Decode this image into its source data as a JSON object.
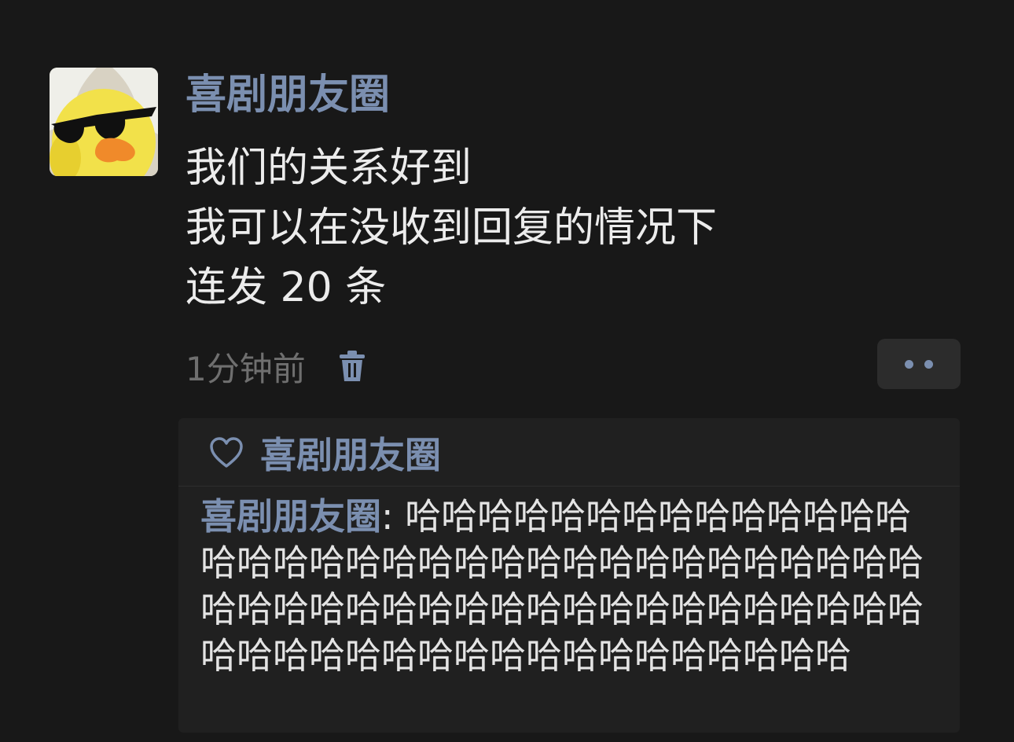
{
  "post": {
    "avatar_icon": "duck-with-sunglasses-avatar",
    "username": "喜剧朋友圈",
    "lines": [
      "我们的关系好到",
      "我可以在没收到回复的情况下",
      "连发 20 条"
    ],
    "timestamp": "1分钟前",
    "delete_icon": "trash-icon",
    "more_icon": "more-dots-icon"
  },
  "interactions": {
    "like_icon": "heart-icon",
    "liked_by": "喜剧朋友圈",
    "comment": {
      "author": "喜剧朋友圈",
      "separator": ": ",
      "text": "哈哈哈哈哈哈哈哈哈哈哈哈哈哈哈哈哈哈哈哈哈哈哈哈哈哈哈哈哈哈哈哈哈哈哈哈哈哈哈哈哈哈哈哈哈哈哈哈哈哈哈哈哈哈哈哈哈哈哈哈哈哈哈哈哈哈哈哈哈哈哈哈"
    }
  },
  "colors": {
    "background": "#181818",
    "name_blue": "#7b8fb0",
    "text": "#ececec",
    "muted": "#6f6f6f",
    "panel": "#202020"
  }
}
